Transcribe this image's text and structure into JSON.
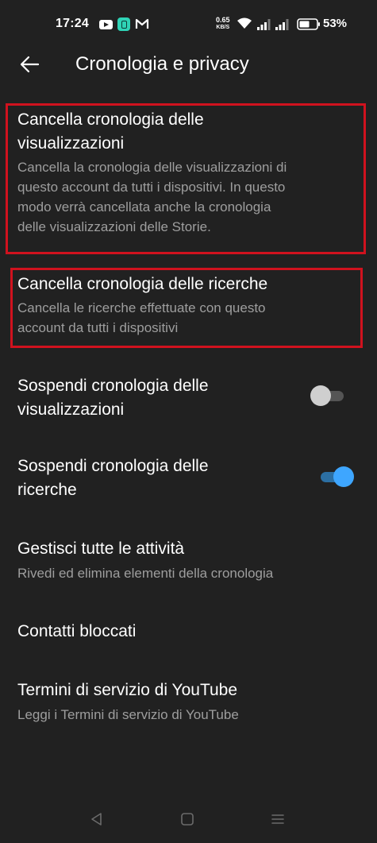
{
  "status_bar": {
    "time": "17:24",
    "net_speed_value": "0.65",
    "net_speed_unit": "KB/S",
    "battery_percent": "53%"
  },
  "header": {
    "title": "Cronologia e privacy"
  },
  "items": [
    {
      "title_lines": [
        "Cancella cronologia delle",
        "visualizzazioni"
      ],
      "subtitle_lines": [
        "Cancella la cronologia delle visualizzazioni di",
        "questo account da tutti i dispositivi. In questo",
        "modo verrà cancellata anche la cronologia",
        "delle visualizzazioni delle Storie."
      ]
    },
    {
      "title_lines": [
        "Cancella cronologia delle ricerche"
      ],
      "subtitle_lines": [
        "Cancella le ricerche effettuate con questo",
        "account da tutti i dispositivi"
      ]
    },
    {
      "title_lines": [
        "Sospendi cronologia delle",
        "visualizzazioni"
      ],
      "toggle_state": "off"
    },
    {
      "title_lines": [
        "Sospendi cronologia delle",
        "ricerche"
      ],
      "toggle_state": "on"
    },
    {
      "title_lines": [
        "Gestisci tutte le attività"
      ],
      "subtitle_lines": [
        "Rivedi ed elimina elementi della cronologia"
      ]
    },
    {
      "title_lines": [
        "Contatti bloccati"
      ]
    },
    {
      "title_lines": [
        "Termini di servizio di YouTube"
      ],
      "subtitle_lines": [
        "Leggi i Termini di servizio di YouTube"
      ]
    }
  ],
  "colors": {
    "background": "#212121",
    "primary_text": "#ffffff",
    "secondary_text": "#9e9e9e",
    "highlight_box": "#d0121e",
    "toggle_on": "#3ea6ff"
  },
  "icons": {
    "back": "back-arrow-icon",
    "nav": [
      "nav-back-icon",
      "nav-home-icon",
      "nav-recents-icon"
    ]
  }
}
